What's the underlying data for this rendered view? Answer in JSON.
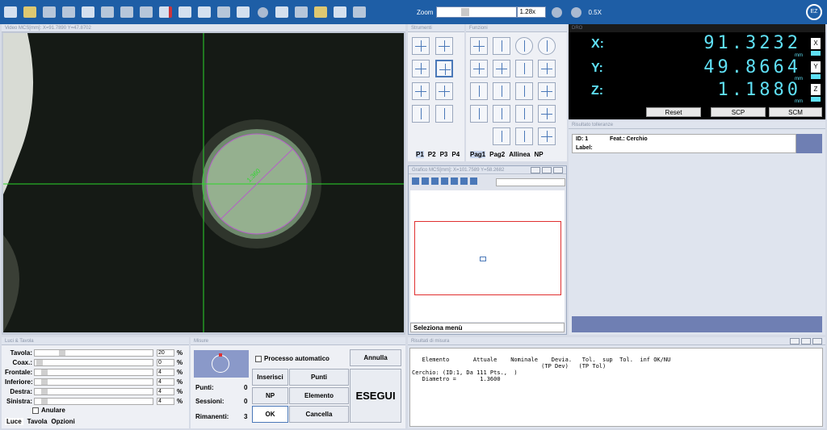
{
  "toolbar": {
    "zoom_label": "Zoom",
    "zoom_value": "1.28x",
    "zoom_step": "0.5X",
    "logo": "EZ"
  },
  "video": {
    "title": "Video MCS[mm]: X=91.7890 Y=47.8702",
    "measure_label": "1.360"
  },
  "strumenti": {
    "title": "Strumenti",
    "pages": [
      "P1",
      "P2",
      "P3",
      "P4"
    ]
  },
  "funzioni": {
    "title": "Funzioni",
    "pages": [
      "Pag1",
      "Pag2",
      "Allinea",
      "NP"
    ]
  },
  "grafico": {
    "title": "Grafico MCS[mm]: X=101.7589 Y=58.2682",
    "status": "Seleziona menù"
  },
  "dro": {
    "title": "DRO",
    "axes": [
      {
        "label": "X:",
        "value": "91.3232",
        "unit": "mm",
        "btn": "X"
      },
      {
        "label": "Y:",
        "value": "49.8664",
        "unit": "mm",
        "btn": "Y"
      },
      {
        "label": "Z:",
        "value": "1.1880",
        "unit": "mm",
        "btn": "Z"
      }
    ],
    "buttons": [
      "Reset",
      "SCP",
      "SCM"
    ]
  },
  "risultato": {
    "title": "Risultato tolleranze",
    "id": "ID: 1",
    "feat": "Feat.: Cerchio",
    "label": "Label:"
  },
  "luci": {
    "title": "Luci & Tavola",
    "sliders": [
      {
        "name": "Tavola:",
        "value": "20",
        "unit": "%"
      },
      {
        "name": "Coax.:",
        "value": "0",
        "unit": "%"
      },
      {
        "name": "Frontale:",
        "value": "4",
        "unit": "%"
      },
      {
        "name": "Inferiore:",
        "value": "4",
        "unit": "%"
      },
      {
        "name": "Destra:",
        "value": "4",
        "unit": "%"
      },
      {
        "name": "Sinistra:",
        "value": "4",
        "unit": "%"
      }
    ],
    "anulare": "Anulare",
    "tabs": [
      "Luce",
      "Tavola",
      "Opzioni"
    ]
  },
  "misure": {
    "title": "Misure",
    "punti_label": "Punti:",
    "punti_value": "0",
    "sessioni_label": "Sessioni:",
    "sessioni_value": "0",
    "rimanenti_label": "Rimanenti:",
    "rimanenti_value": "3",
    "processo": "Processo automatico",
    "annulla": "Annulla",
    "inserisci": "Inserisci",
    "punti_btn": "Punti",
    "np": "NP",
    "elemento": "Elemento",
    "esegui": "ESEGUI",
    "ok": "OK",
    "cancella": "Cancella"
  },
  "risultati_misura": {
    "title": "Risultati di misura",
    "header": "   Elemento       Attuale    Nominale    Devia.   Tol.  sup  Tol.  inf OK/NU",
    "header2": "                                      (TP Dev)   (TP Tol)",
    "line1": "Cerchio: (ID:1, Da 111 Pts.,  )",
    "line2": "   Diametro =       1.3600"
  }
}
